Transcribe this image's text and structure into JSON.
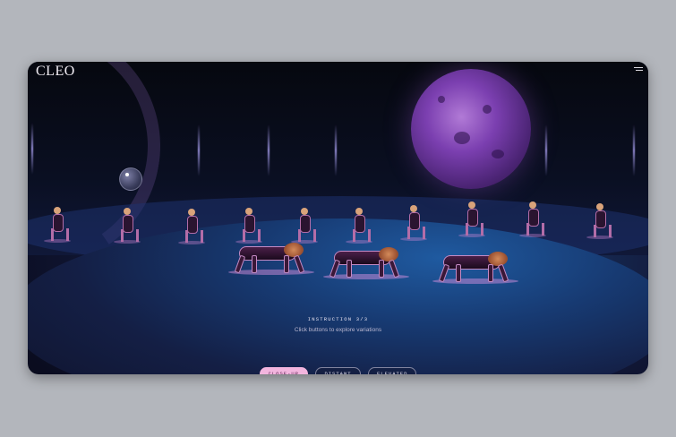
{
  "brand": {
    "logo": "CLEO"
  },
  "instruction": {
    "label": "INSTRUCTION 3/3",
    "hint": "Click buttons to explore variations"
  },
  "view_buttons": [
    {
      "label": "CLOSE-UP",
      "selected": true
    },
    {
      "label": "DISTANT",
      "selected": false
    },
    {
      "label": "ELEVATED",
      "selected": false
    }
  ],
  "colors": {
    "page_background": "#b3b6bc",
    "active_button": "#f2b5de",
    "moon": "#7b3fb0"
  },
  "icons": {
    "menu": "hamburger-menu-icon"
  }
}
